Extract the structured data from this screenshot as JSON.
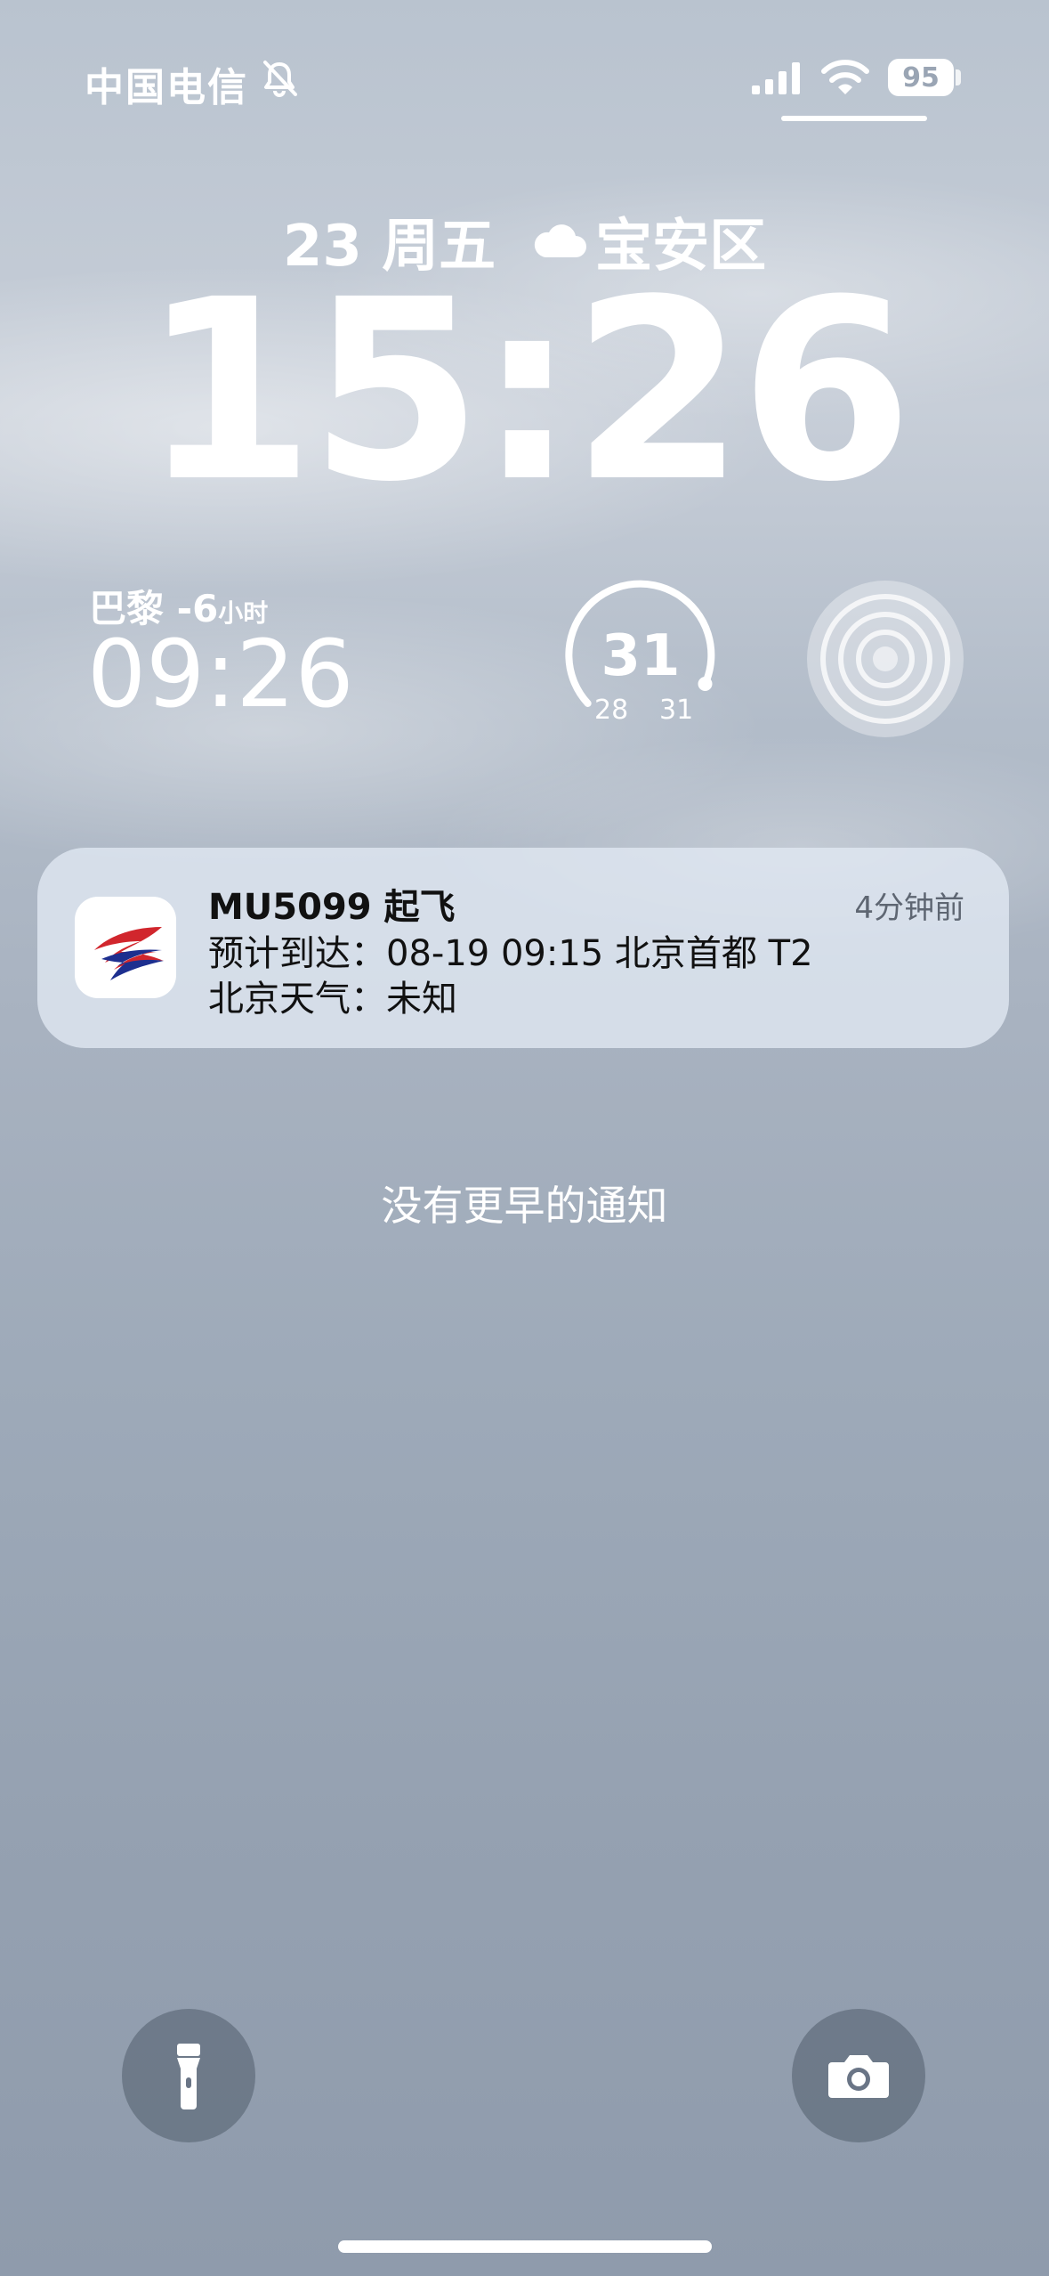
{
  "status_bar": {
    "carrier": "中国电信",
    "battery": "95",
    "icons": [
      "bell-slash-icon",
      "cellular-signal-icon",
      "wifi-icon",
      "battery-icon"
    ]
  },
  "date_line": {
    "date": "23 周五",
    "weather_icon": "cloud-icon",
    "location": "宝安区"
  },
  "clock": "15:26",
  "widgets": {
    "world_clock": {
      "city": "巴黎",
      "offset": "-6",
      "unit": "小时",
      "time": "09:26"
    },
    "weather_gauge": {
      "current": "31",
      "low": "28",
      "high": "31",
      "level": 1.0
    },
    "focus_icon": "target-icon"
  },
  "notification": {
    "app_icon": "china-eastern-logo",
    "title": "MU5099 起飞",
    "time": "4分钟前",
    "line1": "预计到达：08-19 09:15 北京首都 T2",
    "line2": "北京天气：未知"
  },
  "no_older_text": "没有更早的通知",
  "bottom": {
    "left_icon": "flashlight-icon",
    "right_icon": "camera-icon"
  },
  "colors": {
    "notification_bg": "#e1e9f4",
    "logo_red": "#d1262d",
    "logo_blue": "#1d2f8f"
  }
}
